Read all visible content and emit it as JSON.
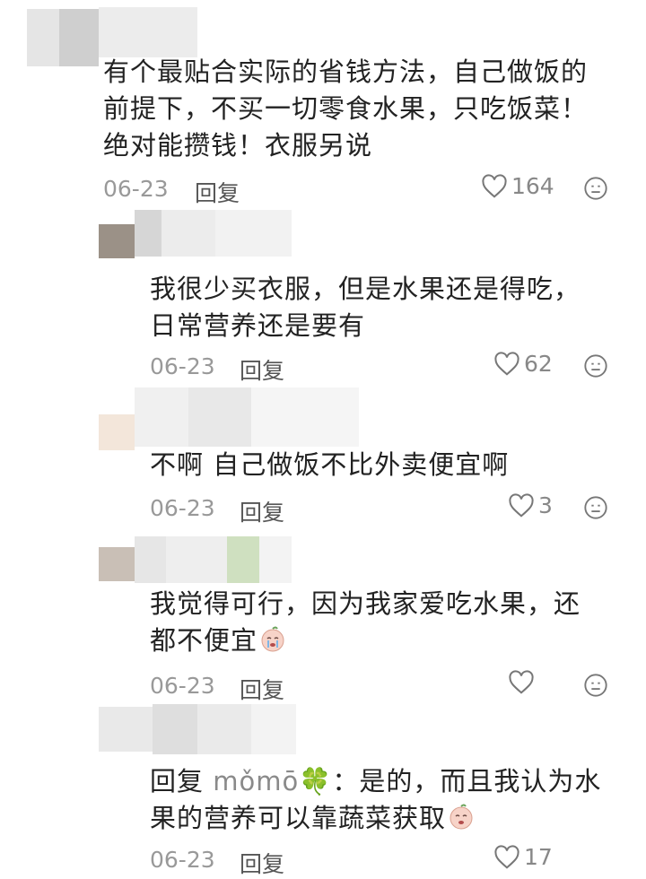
{
  "comments": [
    {
      "text": "有个最贴合实际的省钱方法，自己做饭的前提下，不买一切零食水果，只吃饭菜！绝对能攒钱！衣服另说",
      "lines": [
        "有个最贴合实际的省钱方法，自己做饭的",
        "前提下，不买一切零食水果，只吃饭菜！",
        "绝对能攒钱！衣服另说"
      ],
      "date": "06-23",
      "reply_label": "回复",
      "likes": "164"
    },
    {
      "lines": [
        "我很少买衣服，但是水果还是得吃，",
        "日常营养还是要有"
      ],
      "date": "06-23",
      "reply_label": "回复",
      "likes": "62"
    },
    {
      "lines": [
        "不啊 自己做饭不比外卖便宜啊"
      ],
      "date": "06-23",
      "reply_label": "回复",
      "likes": "3"
    },
    {
      "lines": [
        "我觉得可行，因为我家爱吃水果，还",
        "都不便宜"
      ],
      "date": "06-23",
      "reply_label": "回复",
      "likes": ""
    },
    {
      "reply_prefix": "回复",
      "mention": "mǒmō🍀",
      "line1_rest": "：是的，而且我认为水",
      "line2": "果的营养可以靠蔬菜获取",
      "date": "06-23",
      "reply_label": "回复",
      "likes": "17"
    }
  ],
  "icons": {
    "like": "heart-outline-icon",
    "dislike": "neutral-face-icon",
    "emoji": "crying-face-emoji"
  },
  "colors": {
    "text": "#222222",
    "meta": "#999999",
    "reply": "#555555"
  }
}
